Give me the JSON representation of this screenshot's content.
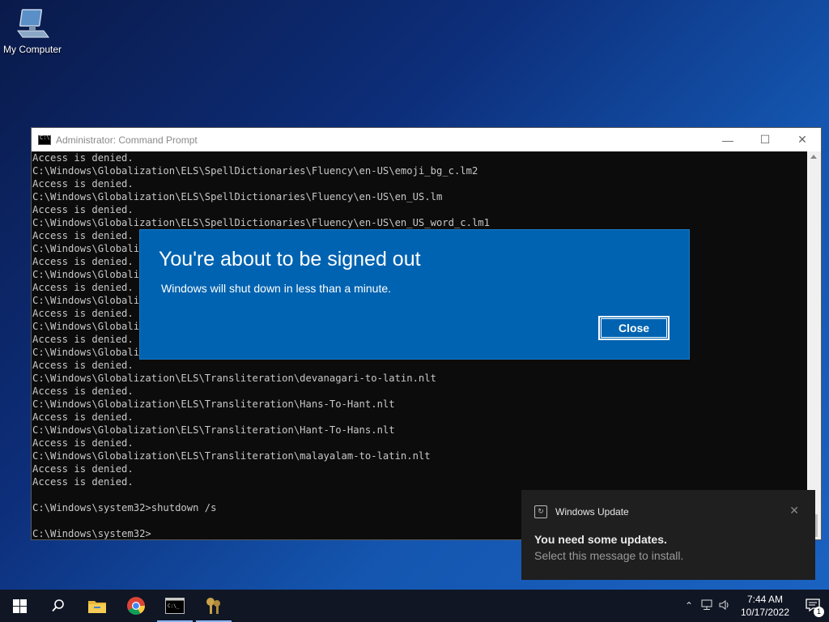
{
  "desktop": {
    "icons": [
      {
        "label": "My Computer",
        "icon": "computer-icon"
      }
    ]
  },
  "cmd": {
    "title": "Administrator: Command Prompt",
    "lines": [
      "Access is denied.",
      "C:\\Windows\\Globalization\\ELS\\SpellDictionaries\\Fluency\\en-US\\emoji_bg_c.lm2",
      "Access is denied.",
      "C:\\Windows\\Globalization\\ELS\\SpellDictionaries\\Fluency\\en-US\\en_US.lm",
      "Access is denied.",
      "C:\\Windows\\Globalization\\ELS\\SpellDictionaries\\Fluency\\en-US\\en_US_word_c.lm1",
      "Access is denied.",
      "C:\\Windows\\Globalization",
      "Access is denied.",
      "C:\\Windows\\Globalization",
      "Access is denied.",
      "C:\\Windows\\Globalization",
      "Access is denied.",
      "C:\\Windows\\Globalization",
      "Access is denied.",
      "C:\\Windows\\Globalization",
      "Access is denied.",
      "C:\\Windows\\Globalization\\ELS\\Transliteration\\devanagari-to-latin.nlt",
      "Access is denied.",
      "C:\\Windows\\Globalization\\ELS\\Transliteration\\Hans-To-Hant.nlt",
      "Access is denied.",
      "C:\\Windows\\Globalization\\ELS\\Transliteration\\Hant-To-Hans.nlt",
      "Access is denied.",
      "C:\\Windows\\Globalization\\ELS\\Transliteration\\malayalam-to-latin.nlt",
      "Access is denied.",
      "Access is denied.",
      "",
      "C:\\Windows\\system32>shutdown /s",
      "",
      "C:\\Windows\\system32>"
    ]
  },
  "dialog": {
    "title": "You're about to be signed out",
    "message": "Windows will shut down in less than a minute.",
    "close_label": "Close"
  },
  "toast": {
    "app": "Windows Update",
    "title": "You need some updates.",
    "body": "Select this message to install."
  },
  "taskbar": {
    "pinned": [
      "start-icon",
      "search-icon",
      "file-explorer-icon",
      "chrome-icon",
      "cmd-icon",
      "keys-icon"
    ],
    "time": "7:44 AM",
    "date": "10/17/2022",
    "notification_count": "1"
  },
  "colors": {
    "dialog_bg": "#0063b1",
    "console_bg": "#0c0c0c",
    "taskbar_bg": "#101623",
    "toast_bg": "#1f1f1f"
  }
}
